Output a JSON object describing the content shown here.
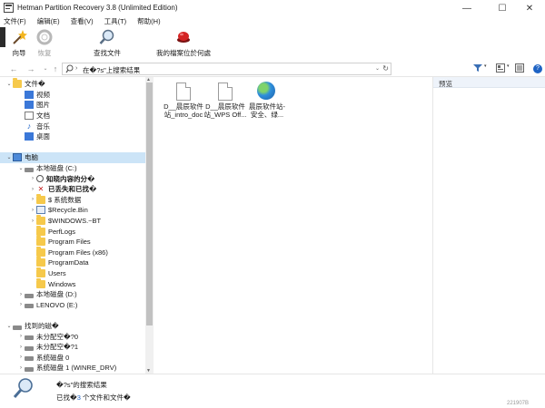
{
  "window": {
    "title": "Hetman Partition Recovery 3.8 (Unlimited Edition)",
    "minimize": "—",
    "maximize": "☐",
    "close": "✕"
  },
  "menu": [
    "文件(F)",
    "编辑(E)",
    "查看(V)",
    "工具(T)",
    "帮助(H)"
  ],
  "toolbar": {
    "wizard": "向导",
    "restore": "恢复",
    "find": "查找文件",
    "favorites": "我的檔案位於何處"
  },
  "address": {
    "path": "在�?s\"上搜索结果",
    "separator": "›"
  },
  "tree": {
    "items": [
      {
        "label": "文件�",
        "icon": "folder",
        "expand": "⌄",
        "indent": 0
      },
      {
        "label": "视频",
        "icon": "video",
        "expand": "",
        "indent": 1
      },
      {
        "label": "图片",
        "icon": "image",
        "expand": "",
        "indent": 1
      },
      {
        "label": "文档",
        "icon": "document",
        "expand": "",
        "indent": 1
      },
      {
        "label": "音乐",
        "icon": "music",
        "expand": "",
        "indent": 1
      },
      {
        "label": "桌面",
        "icon": "desktop",
        "expand": "",
        "indent": 1
      },
      {
        "label": "",
        "icon": "",
        "expand": "",
        "indent": 0
      },
      {
        "label": "电脑",
        "icon": "computer",
        "expand": "⌄",
        "indent": 0,
        "selected": true
      },
      {
        "label": "本地磁盘 (C:)",
        "icon": "drive",
        "expand": "⌄",
        "indent": 1
      },
      {
        "label": "知晓内容的分�",
        "icon": "search",
        "expand": "›",
        "indent": 2,
        "bold": true
      },
      {
        "label": "已丢失和已找�",
        "icon": "lost",
        "expand": "›",
        "indent": 2,
        "bold": true
      },
      {
        "label": "$ 系统数据",
        "icon": "folder",
        "expand": "›",
        "indent": 2
      },
      {
        "label": "$Recycle.Bin",
        "icon": "recycle",
        "expand": "›",
        "indent": 2
      },
      {
        "label": "$WINDOWS.~BT",
        "icon": "folder",
        "expand": "›",
        "indent": 2
      },
      {
        "label": "PerfLogs",
        "icon": "folder",
        "expand": "",
        "indent": 2
      },
      {
        "label": "Program Files",
        "icon": "folder",
        "expand": "",
        "indent": 2
      },
      {
        "label": "Program Files (x86)",
        "icon": "folder",
        "expand": "",
        "indent": 2
      },
      {
        "label": "ProgramData",
        "icon": "folder",
        "expand": "",
        "indent": 2
      },
      {
        "label": "Users",
        "icon": "folder",
        "expand": "",
        "indent": 2
      },
      {
        "label": "Windows",
        "icon": "folder",
        "expand": "",
        "indent": 2
      },
      {
        "label": "本地磁盘 (D:)",
        "icon": "drive",
        "expand": "›",
        "indent": 1
      },
      {
        "label": "LENOVO (E:)",
        "icon": "drive",
        "expand": "›",
        "indent": 1
      },
      {
        "label": "",
        "icon": "",
        "expand": "",
        "indent": 0
      },
      {
        "label": "找到的磁�",
        "icon": "drive",
        "expand": "⌄",
        "indent": 0
      },
      {
        "label": "未分配空�?0",
        "icon": "drive",
        "expand": "›",
        "indent": 1
      },
      {
        "label": "未分配空�?1",
        "icon": "drive",
        "expand": "›",
        "indent": 1
      },
      {
        "label": "系统磁盘 0",
        "icon": "drive",
        "expand": "›",
        "indent": 1
      },
      {
        "label": "系统磁盘 1 (WINRE_DRV)",
        "icon": "drive",
        "expand": "›",
        "indent": 1
      }
    ]
  },
  "files": [
    {
      "line1": "D__晨辰软件",
      "line2": "站_intro_doc",
      "icon": "document"
    },
    {
      "line1": "D__晨辰软件",
      "line2": "站_WPS Off...",
      "icon": "document"
    },
    {
      "line1": "晨辰软件站-",
      "line2": "安全、绿...",
      "icon": "globe"
    }
  ],
  "preview": {
    "title": "预览"
  },
  "status": {
    "line1": "�?s\"的搜索结果",
    "line2_prefix": "已找�",
    "line2_accent": "3",
    "line2_suffix": " 个文件和文件�",
    "corner": "221907B"
  },
  "colors": {
    "selection": "#cce4f7",
    "accent": "#1e63c4",
    "folder": "#f6c94b"
  }
}
